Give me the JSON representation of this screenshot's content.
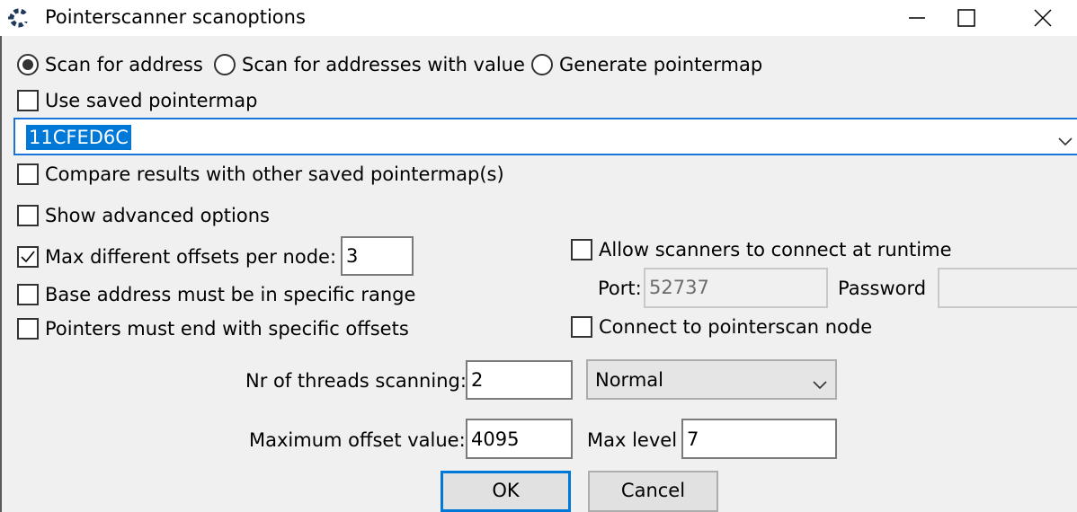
{
  "window": {
    "title": "Pointerscanner scanoptions",
    "icon": "cheat-engine-icon",
    "controls": [
      "minimize-icon",
      "maximize-icon",
      "close-icon"
    ]
  },
  "scan_mode": {
    "options": [
      "Scan for address",
      "Scan for addresses with value",
      "Generate pointermap"
    ],
    "selected": "Scan for address"
  },
  "use_saved_pointermap": {
    "label": "Use saved pointermap",
    "checked": false
  },
  "address": {
    "value": "11CFED6C"
  },
  "compare_results": {
    "label": "Compare results with other saved pointermap(s)",
    "checked": false
  },
  "show_advanced": {
    "label": "Show advanced options",
    "checked": false
  },
  "max_offsets": {
    "label": "Max different offsets per node:",
    "checked": true,
    "value": "3"
  },
  "base_range": {
    "label": "Base address must be in specific range",
    "checked": false
  },
  "end_offsets": {
    "label": "Pointers must end with specific offsets",
    "checked": false
  },
  "allow_connect": {
    "label": "Allow scanners to connect at runtime",
    "checked": false
  },
  "port": {
    "label": "Port:",
    "value": "52737"
  },
  "password": {
    "label": "Password",
    "value": ""
  },
  "connect_node": {
    "label": "Connect to pointerscan node",
    "checked": false
  },
  "threads": {
    "label": "Nr of threads scanning:",
    "value": "2",
    "priority": "Normal"
  },
  "max_offset": {
    "label": "Maximum offset value:",
    "value": "4095"
  },
  "max_level": {
    "label": "Max level",
    "value": "7"
  },
  "buttons": {
    "ok": "OK",
    "cancel": "Cancel"
  },
  "colors": {
    "accent": "#0078d7",
    "selection": "#0078d7",
    "window_bg": "#f0f0f0"
  }
}
